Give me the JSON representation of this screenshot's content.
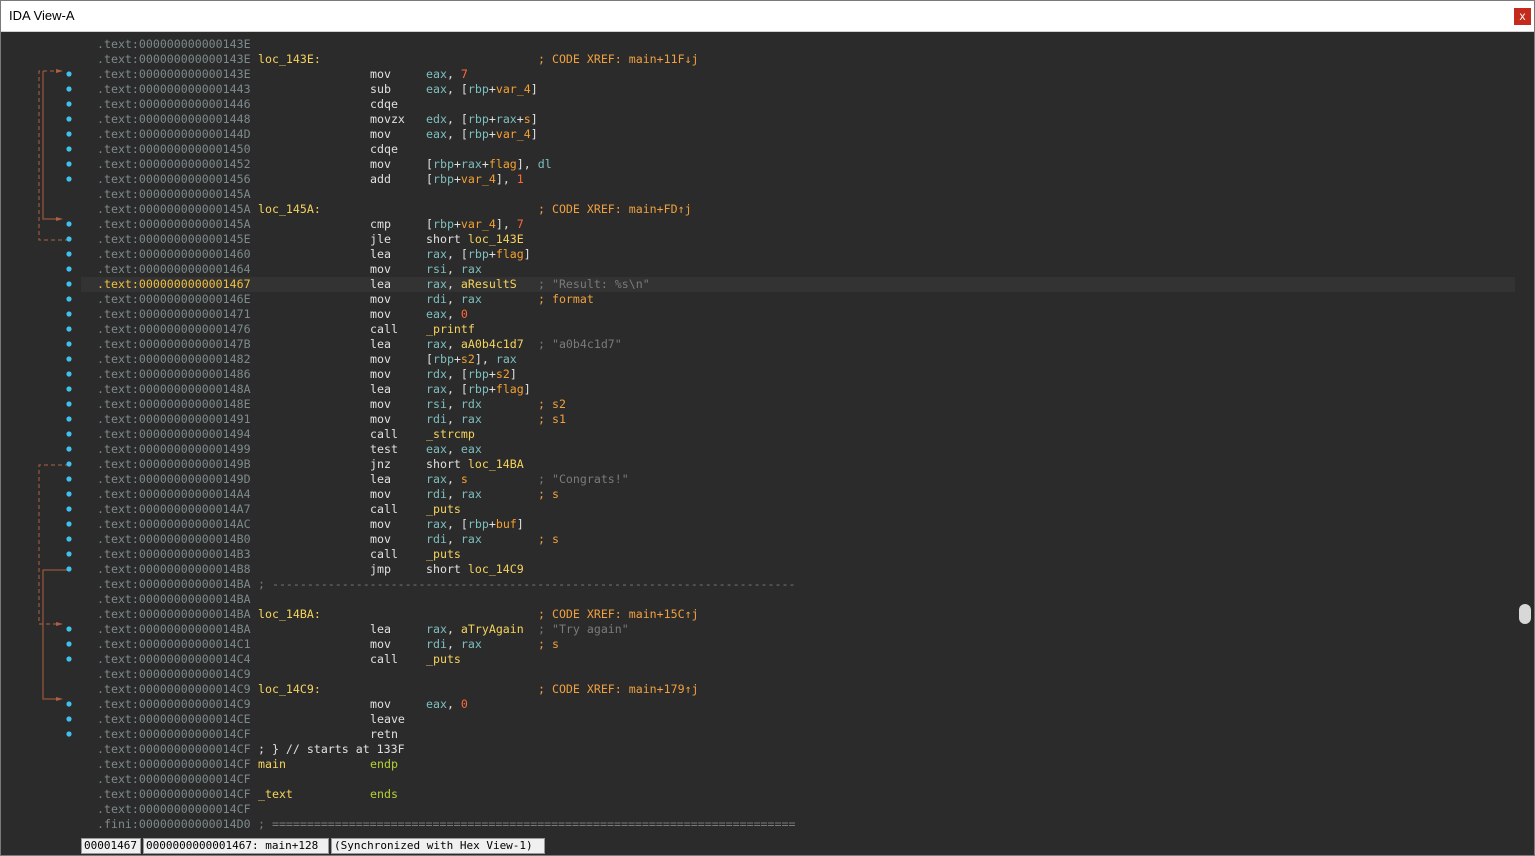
{
  "window": {
    "title": "IDA View-A",
    "close_label": "x"
  },
  "listing": [
    {
      "addr": ".text:000000000000143E"
    },
    {
      "addr": ".text:000000000000143E",
      "label": "loc_143E:",
      "comment": "; CODE XREF: main+11F↓j"
    },
    {
      "addr": ".text:000000000000143E",
      "mnem": "mov",
      "ops": "eax, 7"
    },
    {
      "addr": ".text:0000000000001443",
      "mnem": "sub",
      "ops": "eax, [rbp+var_4]"
    },
    {
      "addr": ".text:0000000000001446",
      "mnem": "cdqe"
    },
    {
      "addr": ".text:0000000000001448",
      "mnem": "movzx",
      "ops": "edx, [rbp+rax+s]"
    },
    {
      "addr": ".text:000000000000144D",
      "mnem": "mov",
      "ops": "eax, [rbp+var_4]"
    },
    {
      "addr": ".text:0000000000001450",
      "mnem": "cdqe"
    },
    {
      "addr": ".text:0000000000001452",
      "mnem": "mov",
      "ops": "[rbp+rax+flag], dl"
    },
    {
      "addr": ".text:0000000000001456",
      "mnem": "add",
      "ops": "[rbp+var_4], 1"
    },
    {
      "addr": ".text:000000000000145A"
    },
    {
      "addr": ".text:000000000000145A",
      "label": "loc_145A:",
      "comment": "; CODE XREF: main+FD↑j"
    },
    {
      "addr": ".text:000000000000145A",
      "mnem": "cmp",
      "ops": "[rbp+var_4], 7"
    },
    {
      "addr": ".text:000000000000145E",
      "mnem": "jle",
      "ops": "short loc_143E"
    },
    {
      "addr": ".text:0000000000001460",
      "mnem": "lea",
      "ops": "rax, [rbp+flag]"
    },
    {
      "addr": ".text:0000000000001464",
      "mnem": "mov",
      "ops": "rsi, rax"
    },
    {
      "addr": ".text:0000000000001467",
      "mnem": "lea",
      "ops": "rax, aResultS",
      "comment": "; \"Result: %s\\n\"",
      "current": true
    },
    {
      "addr": ".text:000000000000146E",
      "mnem": "mov",
      "ops": "rdi, rax",
      "comment": "; format"
    },
    {
      "addr": ".text:0000000000001471",
      "mnem": "mov",
      "ops": "eax, 0"
    },
    {
      "addr": ".text:0000000000001476",
      "mnem": "call",
      "ops": "_printf"
    },
    {
      "addr": ".text:000000000000147B",
      "mnem": "lea",
      "ops": "rax, aA0b4c1d7",
      "comment": "; \"a0b4c1d7\""
    },
    {
      "addr": ".text:0000000000001482",
      "mnem": "mov",
      "ops": "[rbp+s2], rax"
    },
    {
      "addr": ".text:0000000000001486",
      "mnem": "mov",
      "ops": "rdx, [rbp+s2]"
    },
    {
      "addr": ".text:000000000000148A",
      "mnem": "lea",
      "ops": "rax, [rbp+flag]"
    },
    {
      "addr": ".text:000000000000148E",
      "mnem": "mov",
      "ops": "rsi, rdx",
      "comment": "; s2"
    },
    {
      "addr": ".text:0000000000001491",
      "mnem": "mov",
      "ops": "rdi, rax",
      "comment": "; s1"
    },
    {
      "addr": ".text:0000000000001494",
      "mnem": "call",
      "ops": "_strcmp"
    },
    {
      "addr": ".text:0000000000001499",
      "mnem": "test",
      "ops": "eax, eax"
    },
    {
      "addr": ".text:000000000000149B",
      "mnem": "jnz",
      "ops": "short loc_14BA"
    },
    {
      "addr": ".text:000000000000149D",
      "mnem": "lea",
      "ops": "rax, s",
      "comment": "; \"Congrats!\""
    },
    {
      "addr": ".text:00000000000014A4",
      "mnem": "mov",
      "ops": "rdi, rax",
      "comment": "; s"
    },
    {
      "addr": ".text:00000000000014A7",
      "mnem": "call",
      "ops": "_puts"
    },
    {
      "addr": ".text:00000000000014AC",
      "mnem": "mov",
      "ops": "rax, [rbp+buf]"
    },
    {
      "addr": ".text:00000000000014B0",
      "mnem": "mov",
      "ops": "rdi, rax",
      "comment": "; s"
    },
    {
      "addr": ".text:00000000000014B3",
      "mnem": "call",
      "ops": "_puts"
    },
    {
      "addr": ".text:00000000000014B8",
      "mnem": "jmp",
      "ops": "short loc_14C9"
    },
    {
      "addr": ".text:00000000000014BA",
      "separator": "; ---------------------------------------------------------------------------"
    },
    {
      "addr": ".text:00000000000014BA"
    },
    {
      "addr": ".text:00000000000014BA",
      "label": "loc_14BA:",
      "comment": "; CODE XREF: main+15C↑j"
    },
    {
      "addr": ".text:00000000000014BA",
      "mnem": "lea",
      "ops": "rax, aTryAgain",
      "comment": "; \"Try again\""
    },
    {
      "addr": ".text:00000000000014C1",
      "mnem": "mov",
      "ops": "rdi, rax",
      "comment": "; s"
    },
    {
      "addr": ".text:00000000000014C4",
      "mnem": "call",
      "ops": "_puts"
    },
    {
      "addr": ".text:00000000000014C9"
    },
    {
      "addr": ".text:00000000000014C9",
      "label": "loc_14C9:",
      "comment": "; CODE XREF: main+179↑j"
    },
    {
      "addr": ".text:00000000000014C9",
      "mnem": "mov",
      "ops": "eax, 0"
    },
    {
      "addr": ".text:00000000000014CE",
      "mnem": "leave"
    },
    {
      "addr": ".text:00000000000014CF",
      "mnem": "retn"
    },
    {
      "addr": ".text:00000000000014CF",
      "label": "; } // starts at 133F"
    },
    {
      "addr": ".text:00000000000014CF",
      "func": "main",
      "funcdir": "endp"
    },
    {
      "addr": ".text:00000000000014CF"
    },
    {
      "addr": ".text:00000000000014CF",
      "func": "_text",
      "funcdir": "ends"
    },
    {
      "addr": ".text:00000000000014CF"
    },
    {
      "addr": ".fini:00000000000014D0",
      "separator": "; ==========================================================================="
    }
  ],
  "status": {
    "offset": "00001467",
    "location": "0000000000001467: main+128",
    "sync": "(Synchronized with Hex View-1)"
  },
  "colors": {
    "background": "#2b2b2b",
    "address": "#7d8a8c",
    "label": "#f5d35c",
    "comment": "#f0a040",
    "register": "#7fbfbf",
    "number": "#ff6a3d",
    "flow_dot": "#3fc1f0",
    "flow_arrow": "#b06040"
  }
}
